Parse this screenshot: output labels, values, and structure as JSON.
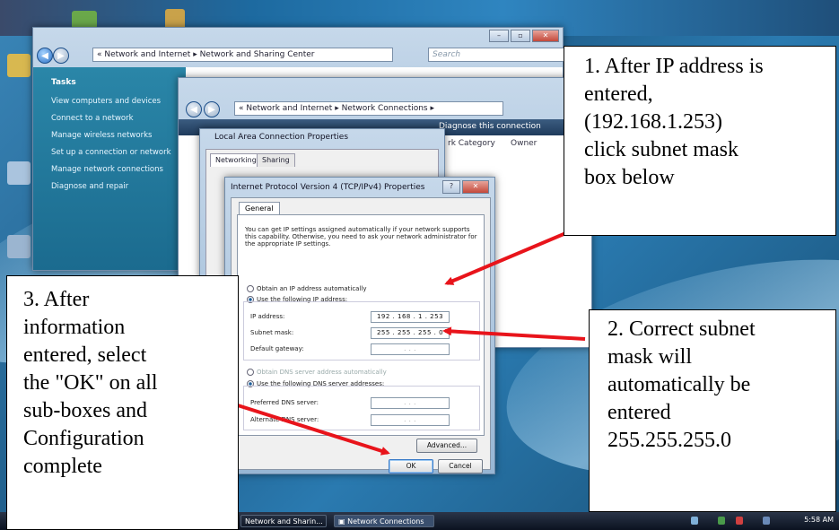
{
  "window_nsc": {
    "breadcrumb": "« Network and Internet ▸ Network and Sharing Center",
    "search_placeholder": "Search",
    "tasks": {
      "heading": "Tasks",
      "items": [
        "View computers and devices",
        "Connect to a network",
        "Manage wireless networks",
        "Set up a connection or network",
        "Manage network connections",
        "Diagnose and repair"
      ]
    }
  },
  "window_nc": {
    "breadcrumb": "« Network and Internet ▸ Network Connections ▸",
    "toolbar_diagnose": "Diagnose this connection",
    "columns": [
      "rk Category",
      "Owner"
    ]
  },
  "window_lacp": {
    "title": "Local Area Connection Properties",
    "tabs": [
      "Networking",
      "Sharing"
    ]
  },
  "dialog": {
    "title": "Internet Protocol Version 4 (TCP/IPv4) Properties",
    "tab": "General",
    "description": "You can get IP settings assigned automatically if your network supports this capability. Otherwise, you need to ask your network administrator for the appropriate IP settings.",
    "radio_auto_ip": "Obtain an IP address automatically",
    "radio_manual_ip": "Use the following IP address:",
    "ip_label": "IP address:",
    "ip_value": "192 . 168 . 1 . 253",
    "subnet_label": "Subnet mask:",
    "subnet_value": "255 . 255 . 255 . 0",
    "gateway_label": "Default gateway:",
    "gateway_value": ". . .",
    "radio_auto_dns": "Obtain DNS server address automatically",
    "radio_manual_dns": "Use the following DNS server addresses:",
    "pref_dns_label": "Preferred DNS server:",
    "pref_dns_value": ". . .",
    "alt_dns_label": "Alternate DNS server:",
    "alt_dns_value": ". . .",
    "advanced_btn": "Advanced...",
    "ok_btn": "OK",
    "cancel_btn": "Cancel"
  },
  "taskbar": {
    "items": [
      "Network and Sharin...",
      "Network Connections"
    ],
    "clock": "5:58 AM"
  },
  "callouts": {
    "c1": "1. After IP address is\nentered,\n(192.168.1.253)\nclick subnet mask\nbox below",
    "c2": "2. Correct subnet\nmask will\nautomatically be\nentered\n255.255.255.0",
    "c3": "3. After\ninformation\nentered, select\nthe \"OK\" on all\nsub-boxes and\nConfiguration\ncomplete"
  },
  "colors": {
    "arrow": "#e8141b",
    "tasks_panel": "#1f7396"
  }
}
